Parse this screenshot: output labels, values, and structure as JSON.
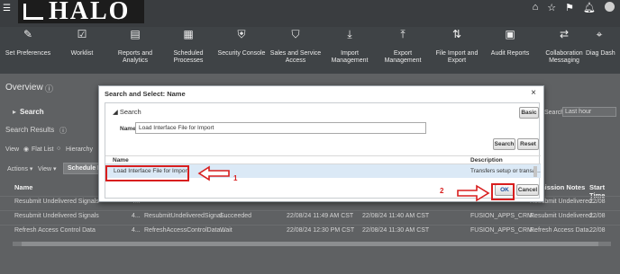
{
  "header": {
    "menu_icon": "hamburger-icon",
    "logo_text": "HALO",
    "right_icons": [
      "home-icon",
      "star-icon",
      "flag-icon",
      "bell-icon",
      "user-icon"
    ]
  },
  "nav": {
    "items": [
      {
        "label": "Set Preferences",
        "icon": "preferences-icon"
      },
      {
        "label": "Worklist",
        "icon": "clipboard-icon"
      },
      {
        "label": "Reports and Analytics",
        "icon": "reports-icon"
      },
      {
        "label": "Scheduled Processes",
        "icon": "calendar-icon"
      },
      {
        "label": "Security Console",
        "icon": "shield-icon"
      },
      {
        "label": "Sales and Service Access",
        "icon": "shield-check-icon"
      },
      {
        "label": "Import Management",
        "icon": "download-icon"
      },
      {
        "label": "Export Management",
        "icon": "upload-icon"
      },
      {
        "label": "File Import and Export",
        "icon": "transfer-icon"
      },
      {
        "label": "Audit Reports",
        "icon": "audit-icon"
      },
      {
        "label": "Collaboration Messaging",
        "icon": "arrows-icon"
      },
      {
        "label": "Diag Dash",
        "icon": "diagnostic-icon"
      }
    ]
  },
  "page": {
    "title": "Overview",
    "search_label": "Search",
    "search_results_label": "Search Results",
    "view_label": "View",
    "flat_list_label": "Flat List",
    "hierarchy_label": "Hierarchy",
    "actions_label": "Actions",
    "view_menu_label": "View",
    "schedule_button": "Schedule Ne",
    "right_search_label": "Search",
    "right_search_value": "Last hour",
    "columns": {
      "name": "Name",
      "notes": "mission Notes",
      "start": "Start Time"
    },
    "rows": [
      {
        "name": "Resubmit Undelivered Signals",
        "id": "4...",
        "process": "",
        "status": "",
        "submitted": "",
        "scheduled": "",
        "submitter": "",
        "notes": "Resubmit Undelivered...",
        "start": "22/08"
      },
      {
        "name": "Resubmit Undelivered Signals",
        "id": "4...",
        "process": "ResubmitUndeliveredSignal...",
        "status": "Succeeded",
        "submitted": "22/08/24 11:49 AM CST",
        "scheduled": "22/08/24 11:40 AM CST",
        "submitter": "FUSION_APPS_CRM...",
        "notes": "Resubmit Undelivered...",
        "start": "22/08"
      },
      {
        "name": "Refresh Access Control Data",
        "id": "4...",
        "process": "RefreshAccessControlData...",
        "status": "Wait",
        "submitted": "22/08/24 12:30 PM CST",
        "scheduled": "22/08/24 11:30 AM CST",
        "submitter": "FUSION_APPS_CRM...",
        "notes": "Refresh Access Data...",
        "start": "22/08"
      }
    ]
  },
  "modal": {
    "title": "Search and Select: Name",
    "close_label": "×",
    "search_section": "Search",
    "basic_button": "Basic",
    "name_label": "Name",
    "name_value": "Load Interface File for Import",
    "search_button": "Search",
    "reset_button": "Reset",
    "columns": {
      "name": "Name",
      "description": "Description"
    },
    "results": [
      {
        "name": "Load Interface File for Import",
        "description": "Transfers setup or transa..."
      }
    ],
    "ok_button": "OK",
    "cancel_button": "Cancel"
  },
  "annotations": {
    "step1": "1",
    "step2": "2",
    "highlight_color": "#d81e1e"
  }
}
